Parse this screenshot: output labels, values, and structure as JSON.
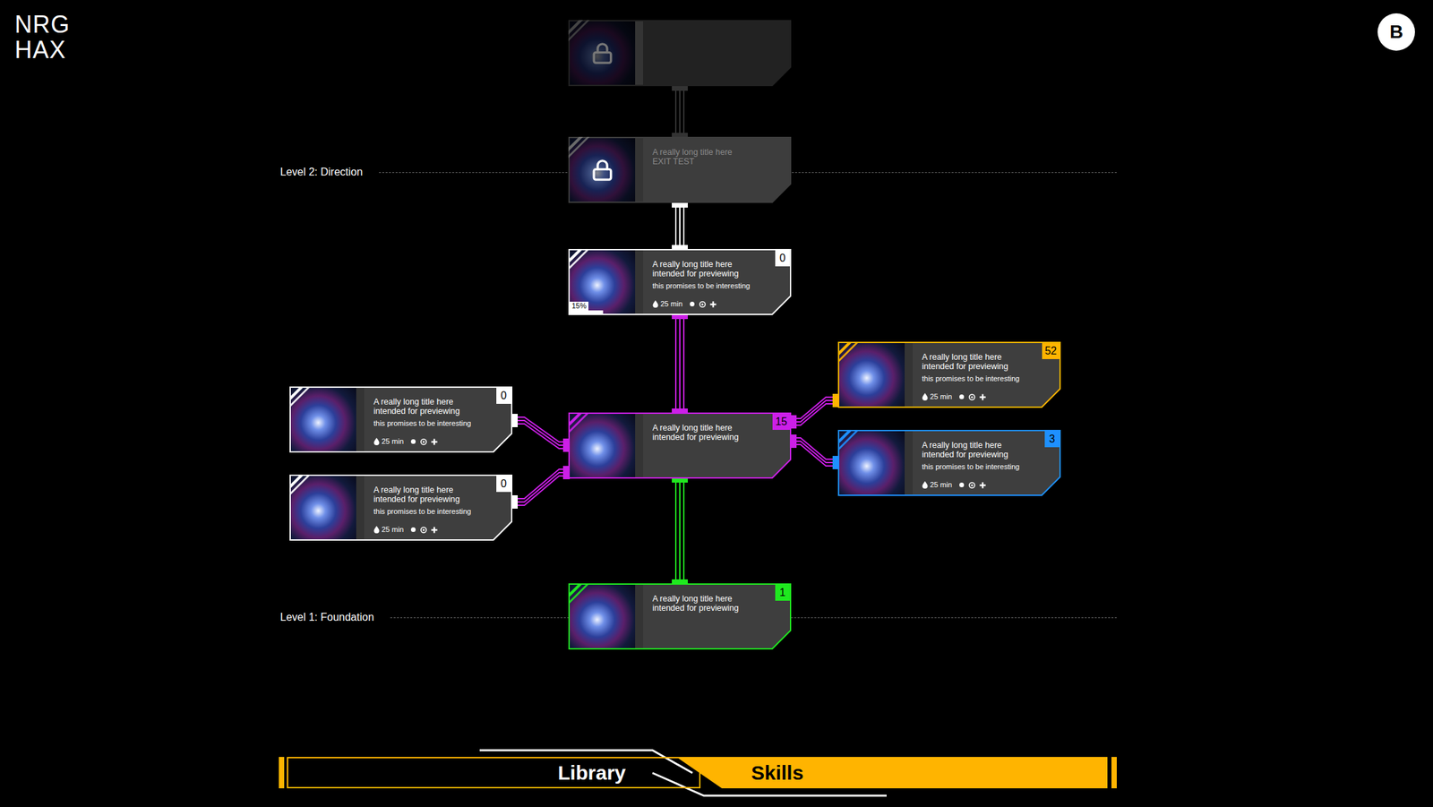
{
  "logo": [
    "NRG",
    "HAX"
  ],
  "back_button": "B",
  "levels": [
    {
      "label": "Level 2: Direction"
    },
    {
      "label": "Level 1: Foundation"
    }
  ],
  "nodes": [
    {
      "locked": true,
      "faded": true,
      "title_lines": [],
      "subtitle": "",
      "duration": "",
      "badge": "",
      "color": "#3a3a3a"
    },
    {
      "locked": true,
      "faded": false,
      "title_lines": [
        "A really long title here",
        "EXIT TEST"
      ],
      "subtitle": "",
      "duration": "",
      "badge": "",
      "color": "#4a4a4a"
    },
    {
      "locked": false,
      "faded": false,
      "title_lines": [
        "A really long title here",
        "intended for previewing"
      ],
      "subtitle": "this promises to be interesting",
      "duration": "25 min",
      "badge": "0",
      "color": "#ffffff",
      "progress": {
        "label": "15%",
        "level": 0.15
      }
    },
    {
      "locked": false,
      "faded": false,
      "title_lines": [
        "A really long title here",
        "intended for previewing"
      ],
      "subtitle": "",
      "duration": "",
      "badge": "15",
      "color": "#cc1fe8"
    },
    {
      "locked": false,
      "faded": false,
      "title_lines": [
        "A really long title here",
        "intended for previewing"
      ],
      "subtitle": "this promises to be interesting",
      "duration": "25 min",
      "badge": "0",
      "color": "#ffffff"
    },
    {
      "locked": false,
      "faded": false,
      "title_lines": [
        "A really long title here",
        "intended for previewing"
      ],
      "subtitle": "this promises to be interesting",
      "duration": "25 min",
      "badge": "0",
      "color": "#ffffff"
    },
    {
      "locked": false,
      "faded": false,
      "title_lines": [
        "A really long title here",
        "intended for previewing"
      ],
      "subtitle": "this promises to be interesting",
      "duration": "25 min",
      "badge": "52",
      "color": "#ffb400"
    },
    {
      "locked": false,
      "faded": false,
      "title_lines": [
        "A really long title here",
        "intended for previewing"
      ],
      "subtitle": "this promises to be interesting",
      "duration": "25 min",
      "badge": "3",
      "color": "#1e90ff"
    },
    {
      "locked": false,
      "faded": false,
      "title_lines": [
        "A really long title here",
        "intended for previewing"
      ],
      "subtitle": "",
      "duration": "",
      "badge": "1",
      "color": "#1fe81f"
    }
  ],
  "tabs": [
    {
      "label": "Library",
      "selected": false
    },
    {
      "label": "Skills",
      "selected": true
    }
  ]
}
